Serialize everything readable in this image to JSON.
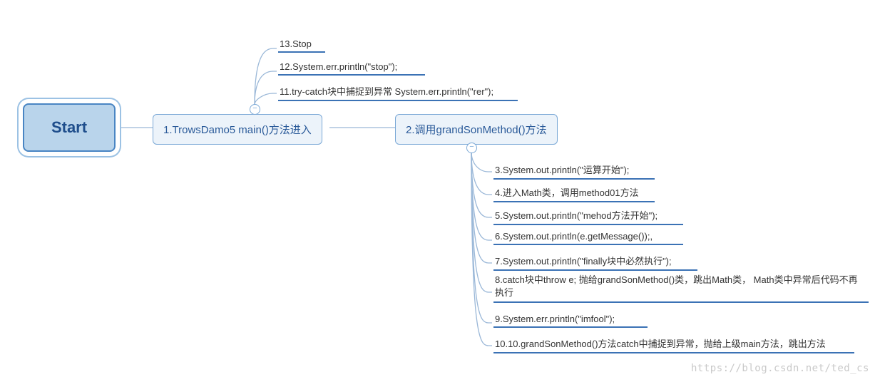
{
  "root": {
    "label": "Start"
  },
  "node1": {
    "label": "1.TrowsDamo5 main()方法进入"
  },
  "node2": {
    "label": "2.调用grandSonMethod()方法"
  },
  "upper": {
    "a": "13.Stop",
    "b": "12.System.err.println(\"stop\");",
    "c": "11.try-catch块中捕捉到异常 System.err.println(\"rer\");"
  },
  "lower": {
    "a": "3.System.out.println(\"运算开始\");",
    "b": "4.进入Math类，调用method01方法",
    "c": "5.System.out.println(\"mehod方法开始\");",
    "d": "6.System.out.println(e.getMessage());,",
    "e": "7.System.out.println(\"finally块中必然执行\");",
    "f": "8.catch块中throw e; 抛给grandSonMethod()类，跳出Math类， Math类中异常后代码不再执行",
    "g": "9.System.err.println(\"imfool\");",
    "h": "10.10.grandSonMethod()方法catch中捕捉到异常，抛给上级main方法，跳出方法"
  },
  "watermark": "https://blog.csdn.net/ted_cs"
}
